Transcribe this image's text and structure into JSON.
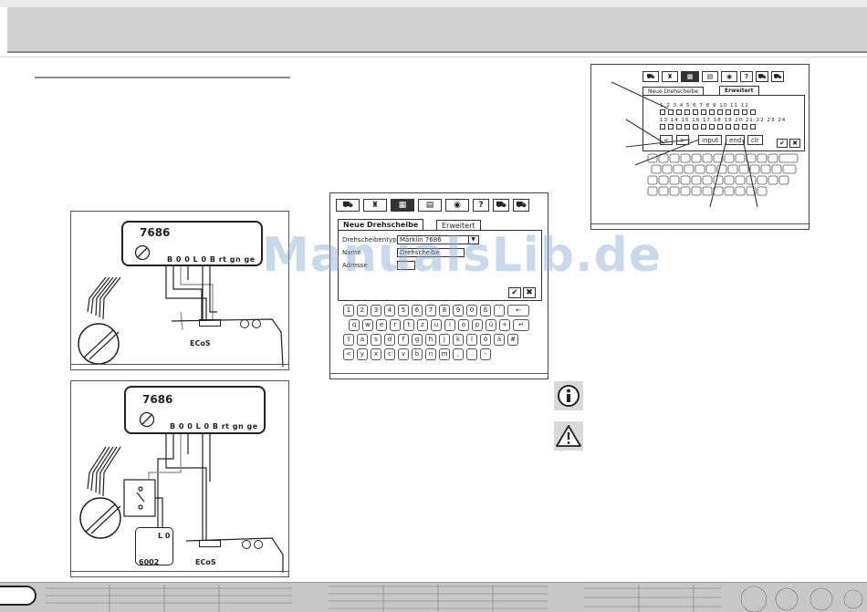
{
  "watermark": "ManualsLib.de",
  "figure1": {
    "module": "7686",
    "pins": "B 0 0 L 0 B rt gn ge",
    "central": "ECoS"
  },
  "figure2": {
    "module": "7686",
    "pins": "B 0 0 L 0 B rt gn ge",
    "central": "ECoS",
    "device": "6002",
    "device_pins": "L 0"
  },
  "screen_main": {
    "toolbar": [
      "⛟",
      "♜",
      "▦",
      "▤",
      "◉",
      "?",
      "⛟",
      "⛟"
    ],
    "tabs": [
      "Neue Drehscheibe",
      "Erweitert"
    ],
    "fields": [
      {
        "label": "Drehscheibentyp",
        "value": "Märklin 7686"
      },
      {
        "label": "Name",
        "value": "Drehscheibe"
      },
      {
        "label": "Adresse",
        "value": ""
      }
    ],
    "ok": "✔",
    "cancel": "✖",
    "keyboard": [
      [
        "1",
        "2",
        "3",
        "4",
        "5",
        "6",
        "7",
        "8",
        "9",
        "0",
        "ß",
        "´",
        "←"
      ],
      [
        "q",
        "w",
        "e",
        "r",
        "t",
        "z",
        "u",
        "i",
        "o",
        "p",
        "ü",
        "+",
        "↵"
      ],
      [
        "⇧",
        "a",
        "s",
        "d",
        "f",
        "g",
        "h",
        "j",
        "k",
        "l",
        "ö",
        "ä",
        "#"
      ],
      [
        "<",
        "y",
        "x",
        "c",
        "v",
        "b",
        "n",
        "m",
        ",",
        ".",
        "-"
      ]
    ]
  },
  "screen_ext": {
    "tabs": [
      "Neue Drehscheibe",
      "Erweitert"
    ],
    "row1_nums": "1 2 3 4 5 6 7 8 9 10 11 12",
    "row2_nums": "13 14 15 16 17 18 19 20 21 22 23 24",
    "buttons": [
      "<",
      ">",
      "input",
      "end",
      "clr"
    ],
    "ok": "✔",
    "cancel": "✖"
  },
  "info_icon": "info-icon",
  "warning_icon": "warning-icon"
}
